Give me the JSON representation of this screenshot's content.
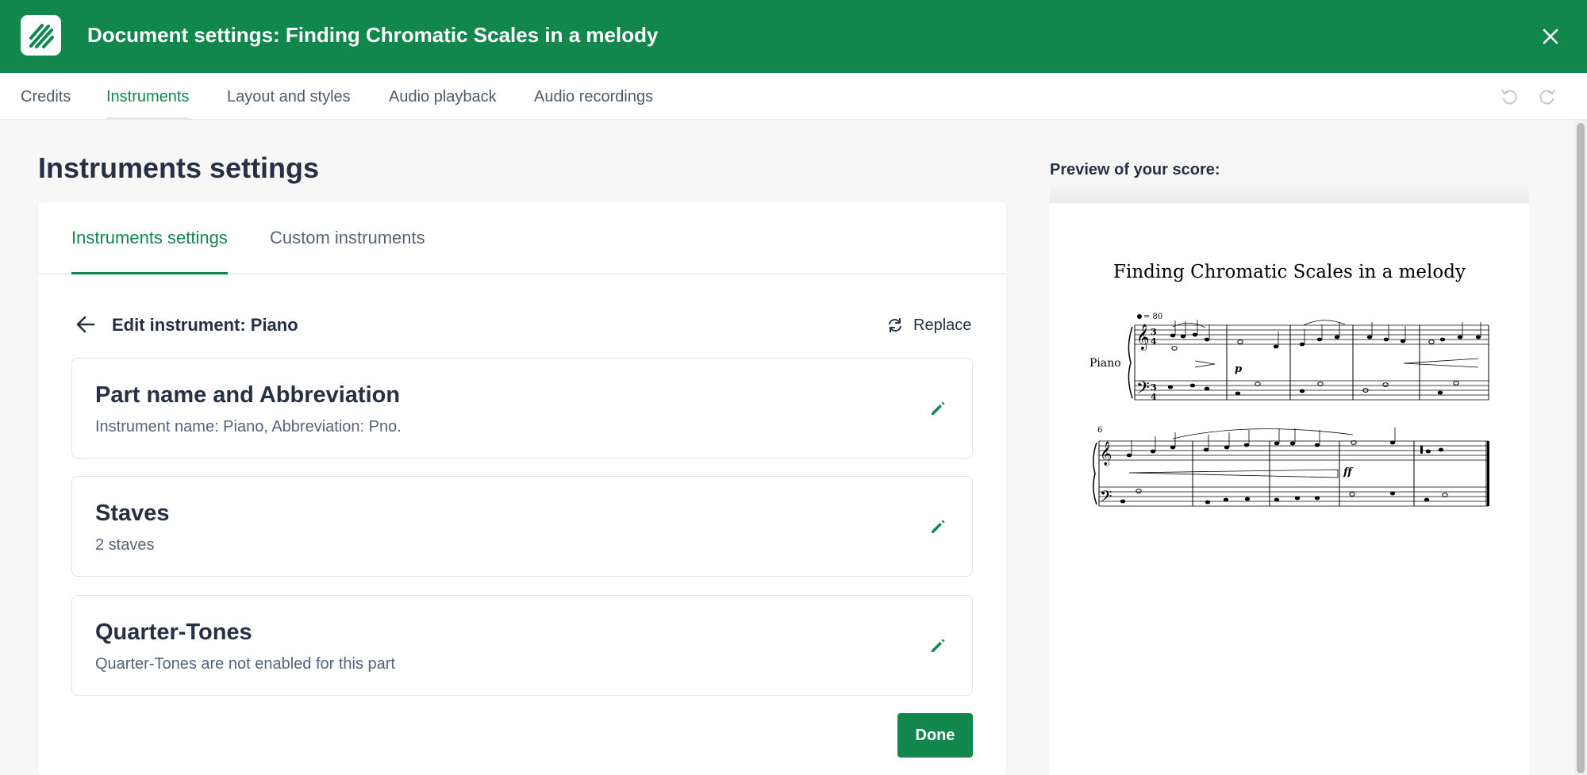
{
  "header": {
    "title": "Document settings: Finding Chromatic Scales in a melody",
    "brand_color": "#12874d"
  },
  "nav": {
    "tabs": [
      "Credits",
      "Instruments",
      "Layout and styles",
      "Audio playback",
      "Audio recordings"
    ],
    "active": "Instruments"
  },
  "main": {
    "page_title": "Instruments settings",
    "subtabs": [
      "Instruments settings",
      "Custom instruments"
    ],
    "active_subtab": "Instruments settings",
    "edit_title": "Edit instrument: Piano",
    "replace_label": "Replace",
    "cards": [
      {
        "title": "Part name and Abbreviation",
        "subtitle": "Instrument name: Piano, Abbreviation: Pno."
      },
      {
        "title": "Staves",
        "subtitle": "2 staves"
      },
      {
        "title": "Quarter-Tones",
        "subtitle": "Quarter-Tones are not enabled for this part"
      }
    ],
    "done_label": "Done"
  },
  "preview": {
    "label": "Preview of your score:",
    "score_title": "Finding Chromatic Scales in a melody",
    "instrument_label": "Piano",
    "tempo": "= 80",
    "time_signature": [
      "3",
      "4"
    ],
    "dynamics": [
      "p",
      "ff"
    ],
    "measure_number": "6"
  },
  "icons": {
    "logo": "flat-logo-icon",
    "close": "close-icon",
    "undo": "undo-icon",
    "redo": "redo-icon",
    "back": "arrow-left-icon",
    "replace": "refresh-icon",
    "edit": "pencil-icon"
  }
}
